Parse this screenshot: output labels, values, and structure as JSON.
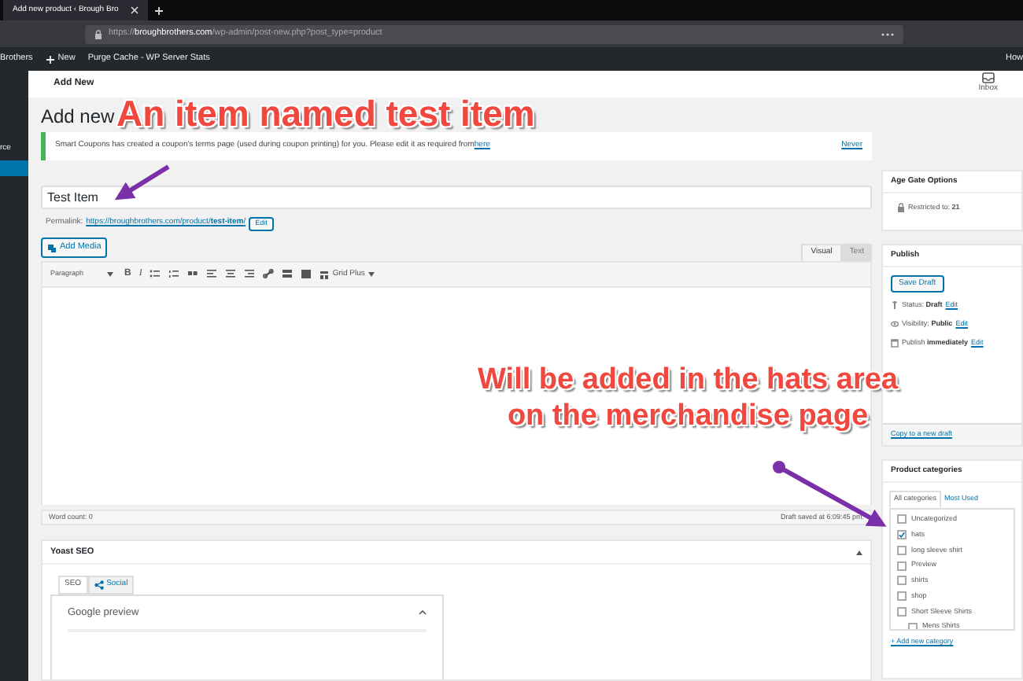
{
  "browser": {
    "tab_title": "Add new product ‹ Brough Bro",
    "url": "https://**broughbrothers.com**/wp-admin/post-new.php?post_type=product"
  },
  "admin_bar": {
    "items": [
      "Brothers",
      "New",
      "Purge Cache - WP Server Stats"
    ],
    "right": "How"
  },
  "sidebar": {
    "items": [
      {
        "label": "rce",
        "selected": false
      },
      {
        "selected": true
      }
    ]
  },
  "header": {
    "title": "Add New",
    "inbox": "Inbox"
  },
  "page_title": "Add new",
  "notice": {
    "text": "Smart Coupons has created a coupon's terms page (used during coupon printing) for you. Please edit it as required from",
    "link": "here",
    "dismiss": "Never"
  },
  "title_field": {
    "value": "Test Item"
  },
  "permalink": {
    "label": "Permalink:",
    "url": "https://broughbrothers.com/product/**test-item**/",
    "button": "Edit"
  },
  "add_media": "Add Media",
  "editor_tabs": [
    {
      "label": "Visual",
      "selected": true
    },
    {
      "label": "Text",
      "selected": false
    }
  ],
  "toolbar": {
    "format": "Paragraph",
    "bold": "B",
    "italic": "I",
    "grid": "Grid Plus"
  },
  "status_bar": {
    "word_count": "Word count: 0",
    "saved": "Draft saved at 6:09:45 pm."
  },
  "yoast": {
    "title": "Yoast SEO",
    "tabs": [
      {
        "label": "SEO",
        "selected": true
      },
      {
        "label": "Social",
        "selected": false
      }
    ],
    "section": "Google preview"
  },
  "age_gate": {
    "title": "Age Gate Options",
    "text": "Restricted to: **21**"
  },
  "publish": {
    "title": "Publish",
    "save": "Save Draft",
    "rows": [
      {
        "kind": "status",
        "text": "Status: **Draft**",
        "link": "Edit"
      },
      {
        "kind": "visibility",
        "text": "Visibility: **Public**",
        "link": "Edit"
      },
      {
        "kind": "schedule",
        "text": "Publish **immediately**",
        "link": "Edit"
      }
    ],
    "copy": "Copy to a new draft"
  },
  "categories": {
    "title": "Product categories",
    "tabs": [
      {
        "label": "All categories",
        "selected": true
      },
      {
        "label": "Most Used",
        "selected": false
      }
    ],
    "items": [
      {
        "label": "Uncategorized",
        "checked": false
      },
      {
        "label": "hats",
        "checked": true
      },
      {
        "label": "long sleeve shirt",
        "checked": false
      },
      {
        "label": "Preview",
        "checked": false
      },
      {
        "label": "shirts",
        "checked": false
      },
      {
        "label": "shop",
        "checked": false
      },
      {
        "label": "Short Sleeve Shirts",
        "checked": false,
        "children": [
          {
            "label": "Mens Shirts",
            "checked": false
          }
        ]
      }
    ],
    "add": "+ Add new category"
  },
  "annotations": [
    {
      "lines": [
        "An item named test item"
      ]
    },
    {
      "lines": [
        "Will be added in the hats area",
        "on the merchandise page"
      ]
    }
  ]
}
